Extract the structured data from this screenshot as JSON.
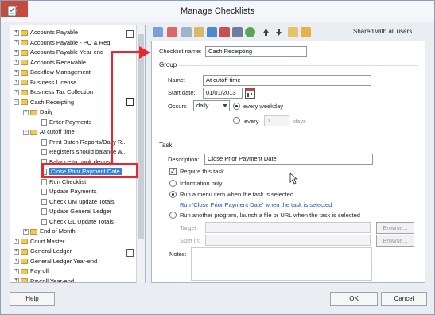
{
  "window": {
    "title": "Manage Checklists",
    "close_glyph": "✕"
  },
  "tree": {
    "items": [
      {
        "label": "Accounts Payable",
        "expander": "+",
        "icon": "folder"
      },
      {
        "label": "Accounts Payable - PO & Req",
        "expander": "+",
        "icon": "folder"
      },
      {
        "label": "Accounts Payable Year-end",
        "expander": "+",
        "icon": "folder"
      },
      {
        "label": "Accounts Receivable",
        "expander": "+",
        "icon": "folder"
      },
      {
        "label": "Backflow Management",
        "expander": "+",
        "icon": "folder"
      },
      {
        "label": "Business License",
        "expander": "+",
        "icon": "folder"
      },
      {
        "label": "Business Tax Collection",
        "expander": "+",
        "icon": "folder"
      },
      {
        "label": "Cash Receipting",
        "expander": "−",
        "icon": "folder"
      },
      {
        "label": "Daily",
        "expander": "−",
        "icon": "folder"
      },
      {
        "label": "Enter Payments",
        "expander": "",
        "icon": "doc"
      },
      {
        "label": "At cutoff time",
        "expander": "−",
        "icon": "folder"
      },
      {
        "label": "Print Batch Reports/Daily R...",
        "expander": "",
        "icon": "doc"
      },
      {
        "label": "Registers should balance w...",
        "expander": "",
        "icon": "doc"
      },
      {
        "label": "Balance to bank deposit",
        "expander": "",
        "icon": "doc"
      },
      {
        "label": "Close Prior Payment Date",
        "expander": "",
        "icon": "doc"
      },
      {
        "label": "Run Checklist",
        "expander": "",
        "icon": "doc"
      },
      {
        "label": "Update Payments",
        "expander": "",
        "icon": "doc"
      },
      {
        "label": "Check UM update Totals",
        "expander": "",
        "icon": "doc"
      },
      {
        "label": "Update General Ledger",
        "expander": "",
        "icon": "doc"
      },
      {
        "label": "Check GL Update Totals",
        "expander": "",
        "icon": "doc"
      },
      {
        "label": "End of Month",
        "expander": "+",
        "icon": "folder"
      },
      {
        "label": "Court Master",
        "expander": "+",
        "icon": "folder"
      },
      {
        "label": "General Ledger",
        "expander": "+",
        "icon": "folder"
      },
      {
        "label": "General Ledger Year-end",
        "expander": "+",
        "icon": "folder"
      },
      {
        "label": "Payroll",
        "expander": "+",
        "icon": "folder"
      },
      {
        "label": "Payroll Year-end",
        "expander": "+",
        "icon": "folder"
      }
    ]
  },
  "toolbar": {
    "shared_label": "Shared with all users..."
  },
  "form": {
    "checklist_name_label": "Checklist name:",
    "checklist_name_value": "Cash Receipting",
    "group_heading": "Group",
    "name_label": "Name:",
    "name_value": "At cutoff time",
    "start_date_label": "Start date:",
    "start_date_value": "01/01/2013",
    "occurs_label": "Occurs",
    "occurs_value": "daily",
    "every_weekday_label": "every weekday",
    "every_label": "every",
    "every_value": "1",
    "days_label": "days",
    "task_heading": "Task",
    "description_label": "Description:",
    "description_value": "Close Prior Payment Date",
    "require_task_label": "Require this task",
    "require_task_check": "✓",
    "info_only_label": "Information only",
    "run_menu_label": "Run a menu item when the task is selected",
    "run_menu_link": "Run 'Close Prior Payment Date' when the task is selected",
    "run_program_label": "Run another program, launch a file or URL when the task is selected",
    "target_label": "Target:",
    "start_in_label": "Start in:",
    "browse_label": "Browse...",
    "notes_label": "Notes:"
  },
  "buttons": {
    "help": "Help",
    "ok": "OK",
    "cancel": "Cancel"
  },
  "colors": {
    "annotation": "#e8262d",
    "selection": "#3b7fd8",
    "link": "#1a4fc4"
  }
}
